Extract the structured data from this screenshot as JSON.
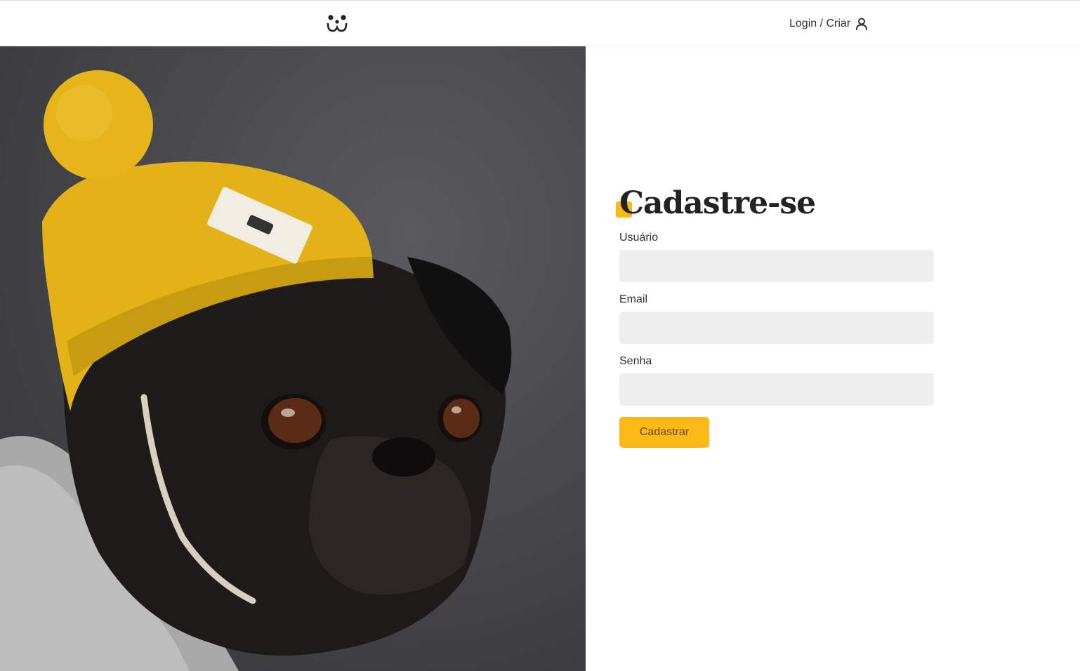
{
  "header": {
    "logo_icon": "dog-face-logo-icon",
    "login_label": "Login / Criar",
    "user_icon": "user-icon"
  },
  "hero_image": {
    "description_icon": "pug-with-yellow-beanie-photo"
  },
  "form": {
    "title": "Cadastre-se",
    "fields": [
      {
        "label": "Usuário",
        "value": "",
        "placeholder": ""
      },
      {
        "label": "Email",
        "value": "",
        "placeholder": ""
      },
      {
        "label": "Senha",
        "value": "",
        "placeholder": ""
      }
    ],
    "submit_label": "Cadastrar"
  },
  "colors": {
    "accent": "#fbb917",
    "button_text": "#764701",
    "input_bg": "#eeeeee",
    "text": "#333333"
  }
}
